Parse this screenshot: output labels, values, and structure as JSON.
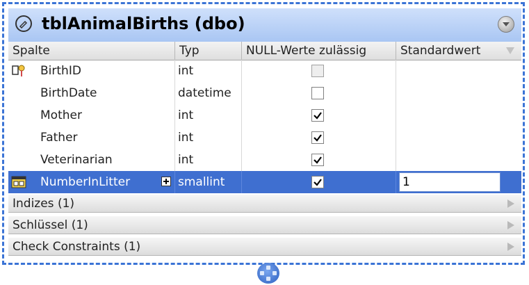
{
  "table": {
    "title": "tblAnimalBirths (dbo)",
    "columns_header": {
      "col": "Spalte",
      "type": "Typ",
      "nullable": "NULL-Werte zulässig",
      "default": "Standardwert"
    },
    "rows": [
      {
        "name": "BirthID",
        "type": "int",
        "nullable": false,
        "nullable_disabled": true,
        "default": "",
        "icon": "primary-key-icon"
      },
      {
        "name": "BirthDate",
        "type": "datetime",
        "nullable": false,
        "nullable_disabled": false,
        "default": ""
      },
      {
        "name": "Mother",
        "type": "int",
        "nullable": true,
        "nullable_disabled": false,
        "default": ""
      },
      {
        "name": "Father",
        "type": "int",
        "nullable": true,
        "nullable_disabled": false,
        "default": ""
      },
      {
        "name": "Veterinarian",
        "type": "int",
        "nullable": true,
        "nullable_disabled": false,
        "default": ""
      },
      {
        "name": "NumberInLitter",
        "type": "smallint",
        "nullable": true,
        "nullable_disabled": false,
        "default": "1",
        "icon": "column-icon",
        "selected": true
      }
    ],
    "sections": [
      {
        "label": "Indizes (1)"
      },
      {
        "label": "Schlüssel (1)"
      },
      {
        "label": "Check Constraints (1)"
      }
    ]
  },
  "colors": {
    "border": "#3b74d6",
    "selection": "#3f6fd0",
    "title_bg": "#bcd4f8"
  }
}
